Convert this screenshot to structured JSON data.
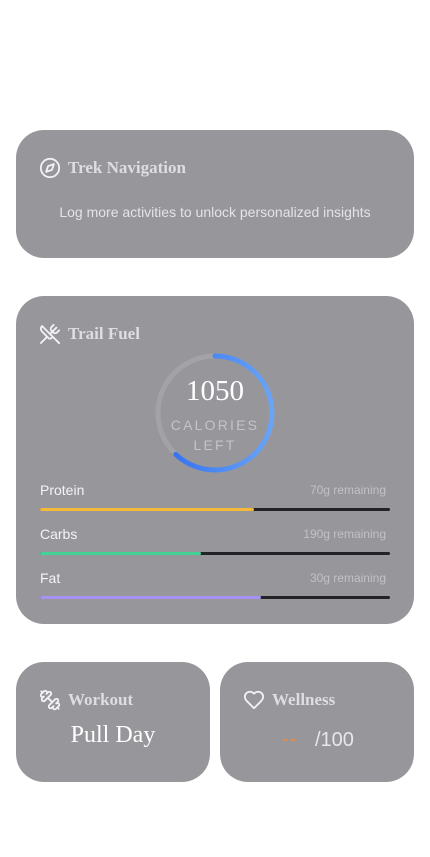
{
  "colors": {
    "card_background": "#97969b",
    "ring_track": "#a3a2a7",
    "ring_progress_start": "#2f6cf0",
    "ring_progress_end": "#6aa4f5",
    "wellness_score": "#f08a3c"
  },
  "trek_navigation": {
    "title": "Trek Navigation",
    "icon": "compass-icon",
    "message": "Log more activities to unlock personalized insights"
  },
  "trail_fuel": {
    "title": "Trail Fuel",
    "icon": "utensils-crossed-icon",
    "calories_value": "1050",
    "calories_label": "CALORIES LEFT",
    "calories_progress": 0.62,
    "macros": [
      {
        "name": "Protein",
        "remaining": "70g remaining",
        "progress": 0.61,
        "color": "#f5b93a"
      },
      {
        "name": "Carbs",
        "remaining": "190g remaining",
        "progress": 0.46,
        "color": "#43d197"
      },
      {
        "name": "Fat",
        "remaining": "30g remaining",
        "progress": 0.63,
        "color": "#a792f4"
      }
    ]
  },
  "workout": {
    "title": "Workout",
    "icon": "dumbbell-icon",
    "value": "Pull Day"
  },
  "wellness": {
    "title": "Wellness",
    "icon": "heart-icon",
    "score": "--",
    "max": "/100"
  }
}
